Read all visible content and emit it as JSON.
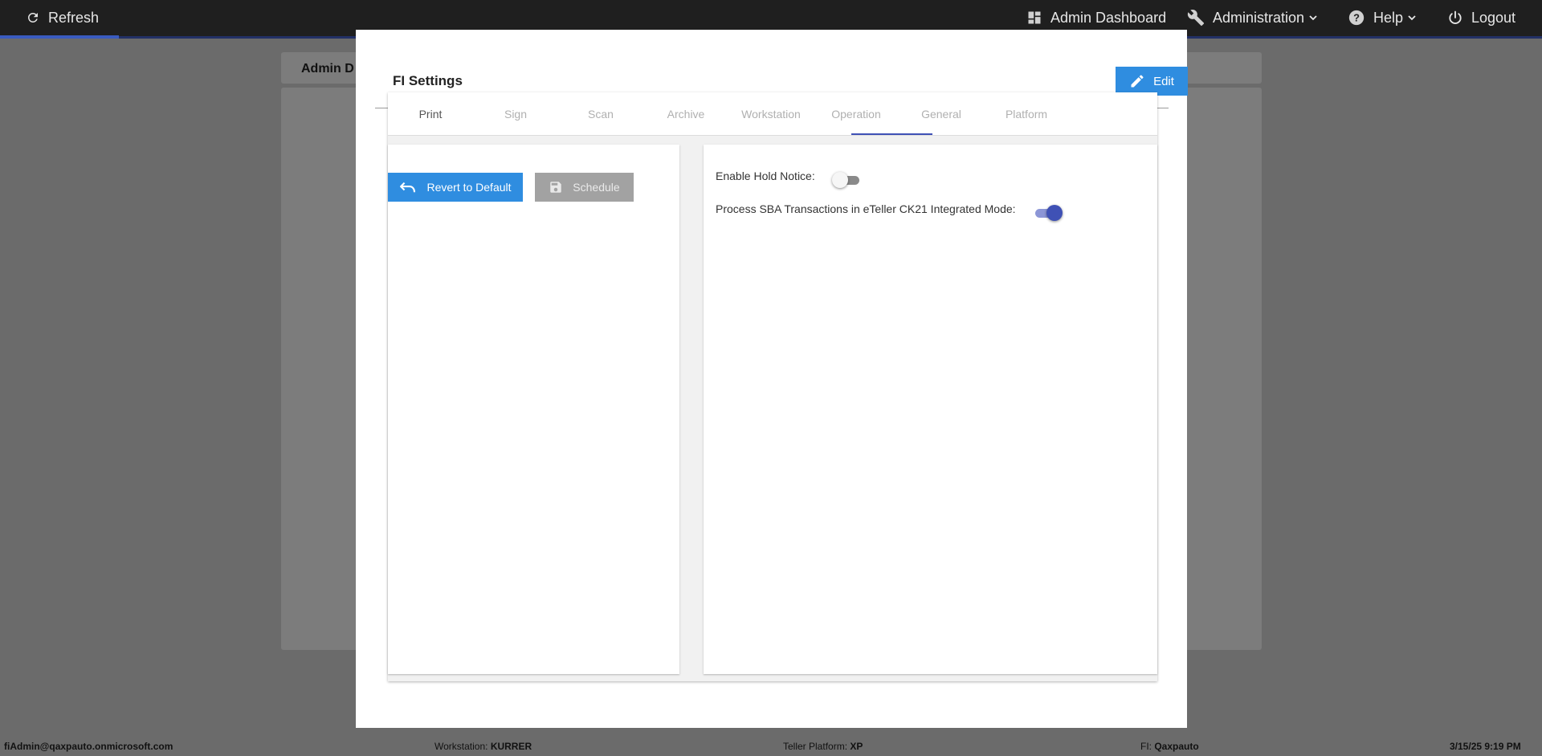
{
  "topbar": {
    "refresh_label": "Refresh",
    "dashboard_label": "Admin Dashboard",
    "administration_label": "Administration",
    "help_label": "Help",
    "logout_label": "Logout"
  },
  "background": {
    "page_title": "Admin D"
  },
  "modal": {
    "title": "FI Settings",
    "edit_label": "Edit",
    "tabs": [
      {
        "label": "Print"
      },
      {
        "label": "Sign"
      },
      {
        "label": "Scan"
      },
      {
        "label": "Archive"
      },
      {
        "label": "Workstation"
      },
      {
        "label": "Operation"
      },
      {
        "label": "General"
      },
      {
        "label": "Platform"
      }
    ],
    "active_tab": "Operation",
    "revert_label": "Revert to Default",
    "schedule_label": "Schedule",
    "settings": [
      {
        "label": "Enable Hold Notice:",
        "enabled": false
      },
      {
        "label": "Process SBA Transactions in eTeller CK21 Integrated Mode:",
        "enabled": true
      }
    ]
  },
  "footer": {
    "user": "fiAdmin@qaxpauto.onmicrosoft.com",
    "workstation_label": "Workstation:",
    "workstation_value": "KURRER",
    "teller_platform_label": "Teller Platform:",
    "teller_platform_value": "XP",
    "fi_label": "FI:",
    "fi_value": "Qaxpauto",
    "datetime": "3/15/25 9:19 PM"
  },
  "colors": {
    "primary_button": "#2f8de0",
    "tab_indicator": "#3f51b5",
    "toggle_on": "#3f51b5",
    "topbar": "#1f1f1f"
  }
}
